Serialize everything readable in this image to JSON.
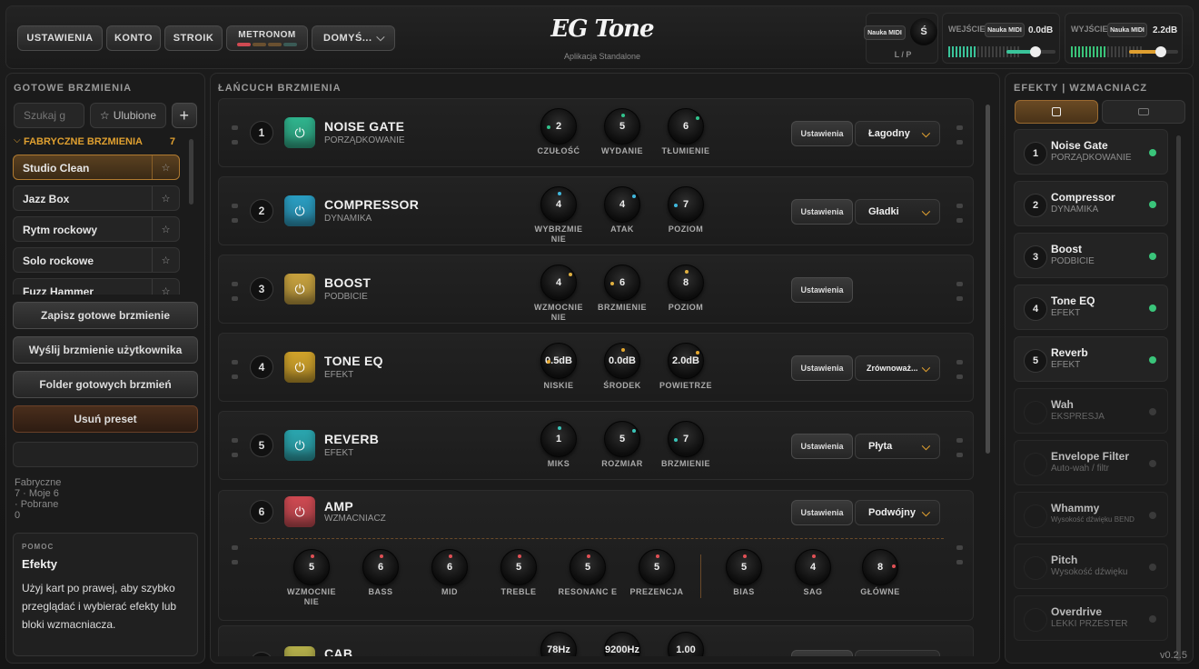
{
  "topbar": {
    "buttons": [
      "USTAWIENIA",
      "KONTO",
      "STROIK"
    ],
    "metronome_label": "METRONOM",
    "preset_dropdown": "DOMYŚ...",
    "logo": "EG Tone",
    "logo_sub": "Aplikacja Standalone",
    "midi_learn": "Nauka MIDI",
    "balance_label": "L / P",
    "balance_knob": "Ś",
    "input_label": "WEJŚCIE",
    "input_value": "0.0dB",
    "input_level": 0.6,
    "output_label": "WYJŚCIE",
    "output_value": "2.2dB",
    "output_level": 0.65
  },
  "left": {
    "title": "GOTOWE BRZMIENIA",
    "search_placeholder": "Szukaj g",
    "favorites_label": "Ulubione",
    "add_label": "+",
    "group_label": "FABRYCZNE BRZMIENIA",
    "group_count": "7",
    "presets": [
      "Studio Clean",
      "Jazz Box",
      "Rytm rockowy",
      "Solo rockowe",
      "Fuzz Hammer"
    ],
    "save_label": "Zapisz gotowe brzmienie",
    "send_label": "Wyślij brzmienie użytkownika",
    "folder_label": "Folder gotowych brzmień",
    "delete_label": "Usuń preset",
    "stats": "Fabryczne 7 · Moje 6 · Pobrane 0",
    "help_caption": "POMOC",
    "help_title": "Efekty",
    "help_text": "Użyj kart po prawej, aby szybko przeglądać i wybierać efekty lub bloki wzmacniacza."
  },
  "chain": {
    "title": "ŁAŃCUCH BRZMIENIA",
    "settings_label": "Ustawienia",
    "rows": [
      {
        "num": "1",
        "name": "NOISE GATE",
        "sub": "PORZĄDKOWANIE",
        "color": "#2fb58e",
        "dot": "#31c28c",
        "select": "Łagodny",
        "knobs": [
          {
            "v": "2",
            "l": "CZUŁOŚĆ"
          },
          {
            "v": "5",
            "l": "WYDANIE"
          },
          {
            "v": "6",
            "l": "TŁUMIENIE"
          }
        ]
      },
      {
        "num": "2",
        "name": "COMPRESSOR",
        "sub": "DYNAMIKA",
        "color": "#2a9fc4",
        "dot": "#40b8dd",
        "select": "Gładki",
        "knobs": [
          {
            "v": "4",
            "l": "WYBRZMIE NIE"
          },
          {
            "v": "4",
            "l": "ATAK"
          },
          {
            "v": "7",
            "l": "POZIOM"
          }
        ]
      },
      {
        "num": "3",
        "name": "BOOST",
        "sub": "PODBICIE",
        "color": "#c9a33e",
        "dot": "#e0b040",
        "select": "",
        "knobs": [
          {
            "v": "4",
            "l": "WZMOCNIE NIE"
          },
          {
            "v": "6",
            "l": "BRZMIENIE"
          },
          {
            "v": "8",
            "l": "POZIOM"
          }
        ]
      },
      {
        "num": "4",
        "name": "TONE EQ",
        "sub": "EFEKT",
        "color": "#d2a42a",
        "dot": "#e5a830",
        "select": "Zrównoważ...",
        "knobs": [
          {
            "v": "0.5dB",
            "l": "NISKIE"
          },
          {
            "v": "0.0dB",
            "l": "ŚRODEK"
          },
          {
            "v": "2.0dB",
            "l": "POWIETRZE"
          }
        ]
      },
      {
        "num": "5",
        "name": "REVERB",
        "sub": "EFEKT",
        "color": "#2aa7b0",
        "dot": "#3ac4b8",
        "select": "Płyta",
        "knobs": [
          {
            "v": "1",
            "l": "MIKS"
          },
          {
            "v": "5",
            "l": "ROZMIAR"
          },
          {
            "v": "7",
            "l": "BRZMIENIE"
          }
        ]
      }
    ],
    "amp": {
      "num": "6",
      "name": "AMP",
      "sub": "WZMACNIACZ",
      "color": "#d04a52",
      "dot": "#e05055",
      "select": "Podwójny",
      "knobs": [
        {
          "v": "5",
          "l": "WZMOCNIE NIE"
        },
        {
          "v": "6",
          "l": "BASS"
        },
        {
          "v": "6",
          "l": "MID"
        },
        {
          "v": "5",
          "l": "TREBLE"
        },
        {
          "v": "5",
          "l": "RESONANC E"
        },
        {
          "v": "5",
          "l": "PREZENCJA"
        },
        {
          "v": "5",
          "l": "BIAS"
        },
        {
          "v": "4",
          "l": "SAG"
        },
        {
          "v": "8",
          "l": "GŁÓWNE"
        }
      ]
    },
    "cab": {
      "name": "CAB",
      "color": "#b5b04a",
      "knobs": [
        "78Hz",
        "9200Hz",
        "1.00"
      ]
    }
  },
  "right": {
    "title": "EFEKTY | WZMACNIACZ",
    "effects": [
      {
        "num": "1",
        "name": "Noise Gate",
        "sub": "PORZĄDKOWANIE",
        "on": true
      },
      {
        "num": "2",
        "name": "Compressor",
        "sub": "DYNAMIKA",
        "on": true
      },
      {
        "num": "3",
        "name": "Boost",
        "sub": "PODBICIE",
        "on": true
      },
      {
        "num": "4",
        "name": "Tone EQ",
        "sub": "EFEKT",
        "on": true
      },
      {
        "num": "5",
        "name": "Reverb",
        "sub": "EFEKT",
        "on": true
      },
      {
        "num": "",
        "name": "Wah",
        "sub": "EKSPRESJA",
        "on": false
      },
      {
        "num": "",
        "name": "Envelope Filter",
        "sub": "Auto-wah / filtr",
        "on": false
      },
      {
        "num": "",
        "name": "Whammy",
        "sub": "Wysokość dźwięku BEND",
        "on": false
      },
      {
        "num": "",
        "name": "Pitch",
        "sub": "Wysokość dźwięku",
        "on": false
      },
      {
        "num": "",
        "name": "Overdrive",
        "sub": "LEKKI PRZESTER",
        "on": false
      }
    ],
    "version": "v0.2.5"
  },
  "colors": {
    "accent": "#e0a030",
    "led_on": "#3ac47a",
    "input_slider": "#3ac49a",
    "output_slider": "#e0a030"
  }
}
